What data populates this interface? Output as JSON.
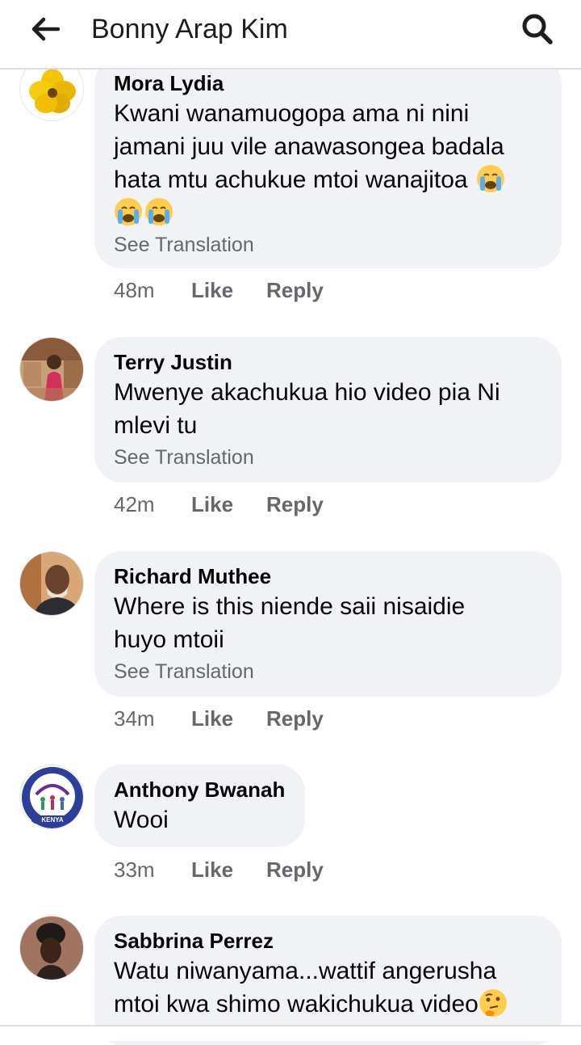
{
  "header": {
    "title": "Bonny Arap Kim",
    "back_icon": "arrow-left-icon",
    "search_icon": "search-icon"
  },
  "comments": [
    {
      "name": "Mora Lydia",
      "lines": [
        "Kwani wanamuogopa ama ni nini",
        "jamani juu vile anawasongea badala",
        "hata mtu achukue mtoi wanajitoa"
      ],
      "emoji": "crying-face",
      "see_translation": "See Translation",
      "time": "48m",
      "like": "Like",
      "reply": "Reply"
    },
    {
      "name": "Terry Justin",
      "lines": [
        "Mwenye akachukua hio video pia Ni",
        "mlevi tu"
      ],
      "see_translation": "See Translation",
      "time": "42m",
      "like": "Like",
      "reply": "Reply"
    },
    {
      "name": "Richard Muthee",
      "lines": [
        "Where is this niende saii nisaidie",
        "huyo mtoii"
      ],
      "see_translation": "See Translation",
      "time": "34m",
      "like": "Like",
      "reply": "Reply"
    },
    {
      "name": "Anthony Bwanah",
      "lines": [
        "Wooi"
      ],
      "avatar_text": "KENYA",
      "time": "33m",
      "like": "Like",
      "reply": "Reply"
    },
    {
      "name": "Sabbrina Perrez",
      "lines": [
        "Watu niwanyama...wattif angerusha",
        "mtoi kwa shimo wakichukua video"
      ],
      "emoji": "thinking-face"
    }
  ],
  "colors": {
    "bubble": "#f0f2f5",
    "meta_text": "#65676b",
    "divider": "#dadde1"
  }
}
